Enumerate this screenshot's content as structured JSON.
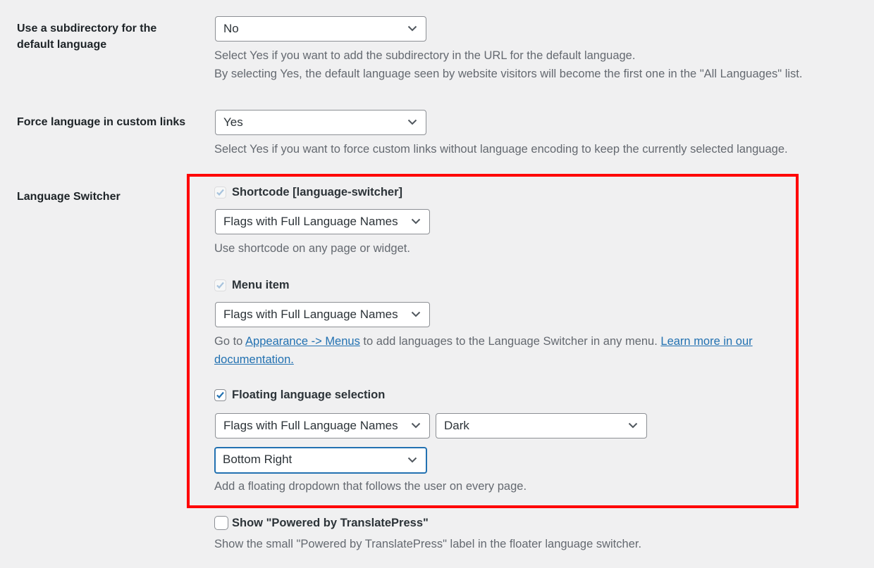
{
  "settings": {
    "subdirectory": {
      "label_line1": "Use a subdirectory for the",
      "label_line2": "default language",
      "value": "No",
      "desc_line1": "Select Yes if you want to add the subdirectory in the URL for the default language.",
      "desc_line2": "By selecting Yes, the default language seen by website visitors will become the first one in the \"All Languages\" list."
    },
    "force_language": {
      "label": "Force language in custom links",
      "value": "Yes",
      "desc": "Select Yes if you want to force custom links without language encoding to keep the currently selected language."
    },
    "language_switcher": {
      "label": "Language Switcher",
      "shortcode": {
        "checkbox_label": "Shortcode [language-switcher]",
        "checked": true,
        "disabled": true,
        "select_value": "Flags with Full Language Names",
        "desc": "Use shortcode on any page or widget."
      },
      "menu_item": {
        "checkbox_label": "Menu item",
        "checked": true,
        "disabled": true,
        "select_value": "Flags with Full Language Names",
        "desc_prefix": "Go to ",
        "desc_link1": "Appearance -> Menus",
        "desc_middle": " to add languages to the Language Switcher in any menu. ",
        "desc_link2_part1": "Learn more in our",
        "desc_link2_part2": "documentation."
      },
      "floating": {
        "checkbox_label": "Floating language selection",
        "checked": true,
        "style_value": "Flags with Full Language Names",
        "theme_value": "Dark",
        "position_value": "Bottom Right",
        "desc": "Add a floating dropdown that follows the user on every page."
      },
      "powered_by": {
        "checkbox_label": "Show \"Powered by TranslatePress\"",
        "checked": false,
        "desc": "Show the small \"Powered by TranslatePress\" label in the floater language switcher."
      }
    }
  },
  "colors": {
    "accent": "#2271b1",
    "highlight": "#ff0000",
    "background": "#f0f0f1"
  }
}
